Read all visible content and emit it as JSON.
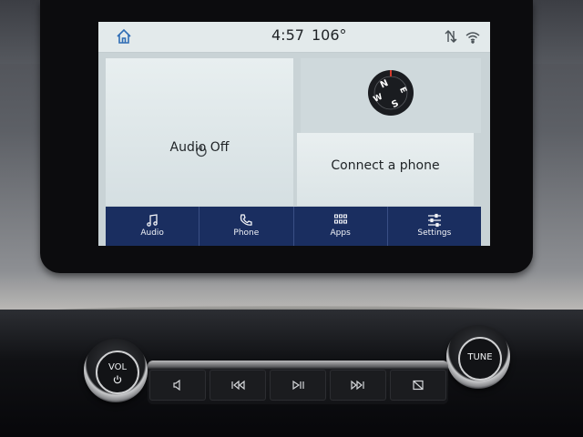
{
  "status": {
    "time": "4:57",
    "temperature": "106°"
  },
  "tiles": {
    "audio_label": "Audio Off",
    "phone_label": "Connect a phone"
  },
  "compass": {
    "n": "N",
    "e": "E",
    "s": "S",
    "w": "W"
  },
  "nav": {
    "items": [
      {
        "label": "Audio",
        "icon": "music-note-icon"
      },
      {
        "label": "Phone",
        "icon": "phone-icon"
      },
      {
        "label": "Apps",
        "icon": "apps-grid-icon"
      },
      {
        "label": "Settings",
        "icon": "sliders-icon"
      }
    ]
  },
  "knobs": {
    "vol_label": "VOL",
    "tune_label": "TUNE"
  },
  "colors": {
    "nav_bg": "#1a2e60",
    "home_icon": "#2f6db5",
    "screen_bg": "#c9d3d6"
  }
}
